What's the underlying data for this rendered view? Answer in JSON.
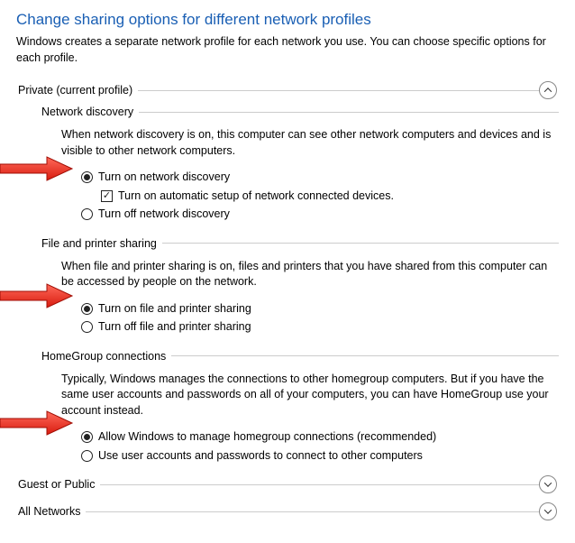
{
  "page": {
    "title": "Change sharing options for different network profiles",
    "subtitle": "Windows creates a separate network profile for each network you use. You can choose specific options for each profile."
  },
  "profiles": {
    "private": {
      "label": "Private (current profile)"
    },
    "guest": {
      "label": "Guest or Public"
    },
    "all": {
      "label": "All Networks"
    }
  },
  "sections": {
    "nd": {
      "title": "Network discovery",
      "desc": "When network discovery is on, this computer can see other network computers and devices and is visible to other network computers.",
      "on": "Turn on network discovery",
      "auto": "Turn on automatic setup of network connected devices.",
      "off": "Turn off network discovery"
    },
    "fps": {
      "title": "File and printer sharing",
      "desc": "When file and printer sharing is on, files and printers that you have shared from this computer can be accessed by people on the network.",
      "on": "Turn on file and printer sharing",
      "off": "Turn off file and printer sharing"
    },
    "hg": {
      "title": "HomeGroup connections",
      "desc": "Typically, Windows manages the connections to other homegroup computers. But if you have the same user accounts and passwords on all of your computers, you can have HomeGroup use your account instead.",
      "auto": "Allow Windows to manage homegroup connections (recommended)",
      "user": "Use user accounts and passwords to connect to other computers"
    }
  }
}
